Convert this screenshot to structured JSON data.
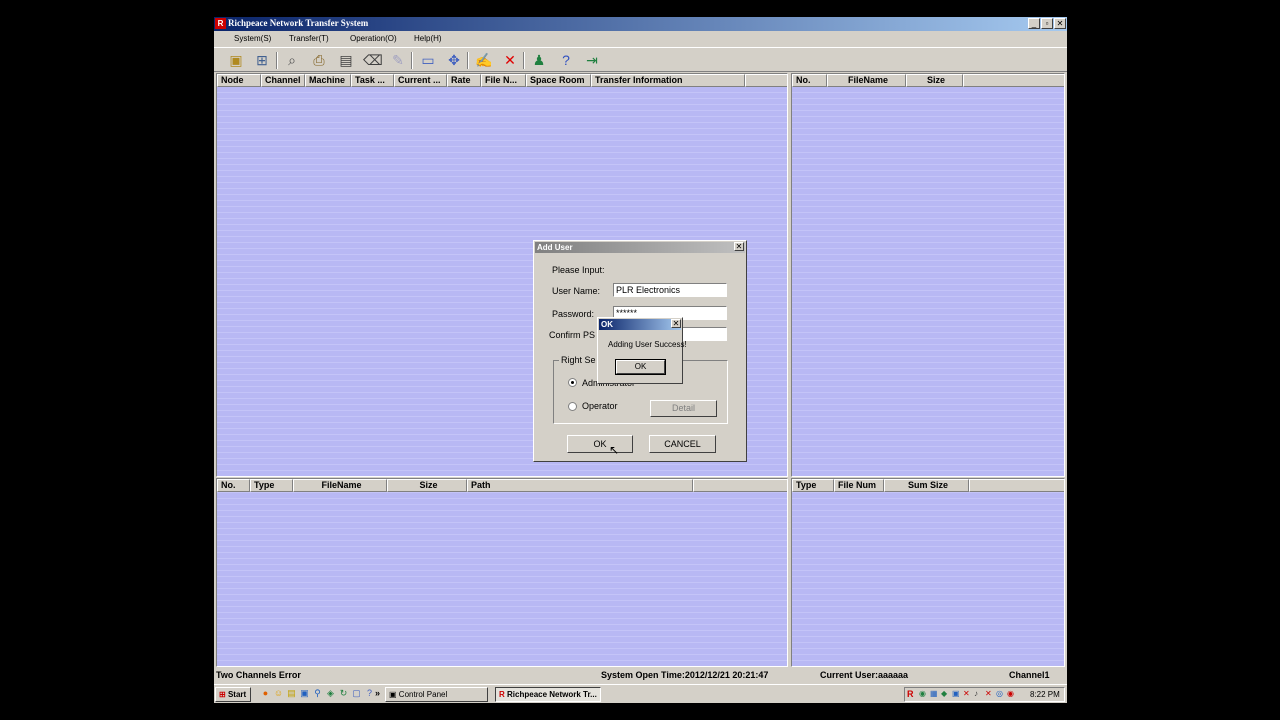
{
  "window": {
    "title": "Richpeace Network Transfer System",
    "app_icon": "R"
  },
  "menu": [
    "System(S)",
    "Transfer(T)",
    "Operation(O)",
    "Help(H)"
  ],
  "toolbar_icons": [
    "open-icon",
    "network-icon",
    "search-icon",
    "printer-icon",
    "folder-icon",
    "trash-icon",
    "wrench-icon",
    "select-icon",
    "move-icon",
    "edit-icon",
    "delete-icon",
    "user-icon",
    "help-icon",
    "exit-icon"
  ],
  "top_left_columns": [
    "Node",
    "Channel",
    "Machine",
    "Task ...",
    "Current ...",
    "Rate",
    "File N...",
    "Space Room",
    "Transfer Information"
  ],
  "top_right_columns": [
    "No.",
    "FileName",
    "Size"
  ],
  "bottom_left_columns": [
    "No.",
    "Type",
    "FileName",
    "Size",
    "Path"
  ],
  "bottom_right_columns": [
    "Type",
    "File Num",
    "Sum Size"
  ],
  "status": {
    "left": "Two Channels Error",
    "open_time": "System Open Time:2012/12/21  20:21:47",
    "user": "Current User:aaaaaa",
    "channel": "Channel1"
  },
  "add_user": {
    "title": "Add User",
    "please_input": "Please Input:",
    "user_name_label": "User Name:",
    "user_name_value": "PLR Electronics",
    "password_label": "Password:",
    "password_value": "******",
    "confirm_label": "Confirm PS",
    "right_label": "Right Se",
    "admin_label": "Administrator",
    "operator_label": "Operator",
    "detail_button": "Detail",
    "ok_button": "OK",
    "cancel_button": "CANCEL"
  },
  "message": {
    "title": "OK",
    "text": "Adding User Success!",
    "ok_button": "OK"
  },
  "taskbar": {
    "start": "Start",
    "more": "»",
    "task_control_panel": "Control Panel",
    "task_app": "Richpeace Network Tr...",
    "clock": "8:22 PM"
  }
}
